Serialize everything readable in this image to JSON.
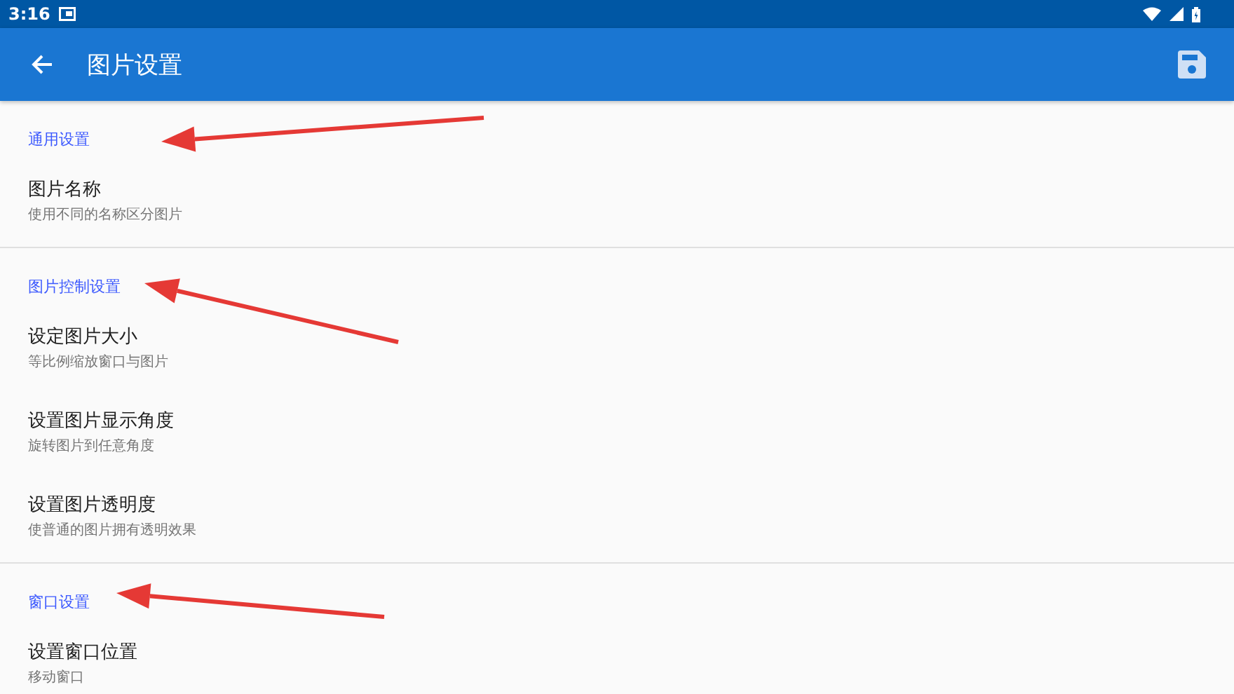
{
  "status_bar": {
    "time": "3:16"
  },
  "app_bar": {
    "title": "图片设置"
  },
  "sections": [
    {
      "header": "通用设置",
      "arrow": true,
      "items": [
        {
          "title": "图片名称",
          "summary": "使用不同的名称区分图片"
        }
      ]
    },
    {
      "header": "图片控制设置",
      "arrow": true,
      "items": [
        {
          "title": "设定图片大小",
          "summary": "等比例缩放窗口与图片"
        },
        {
          "title": "设置图片显示角度",
          "summary": "旋转图片到任意角度"
        },
        {
          "title": "设置图片透明度",
          "summary": "使普通的图片拥有透明效果"
        }
      ]
    },
    {
      "header": "窗口设置",
      "arrow": true,
      "items": [
        {
          "title": "设置窗口位置",
          "summary": "移动窗口"
        }
      ]
    }
  ]
}
